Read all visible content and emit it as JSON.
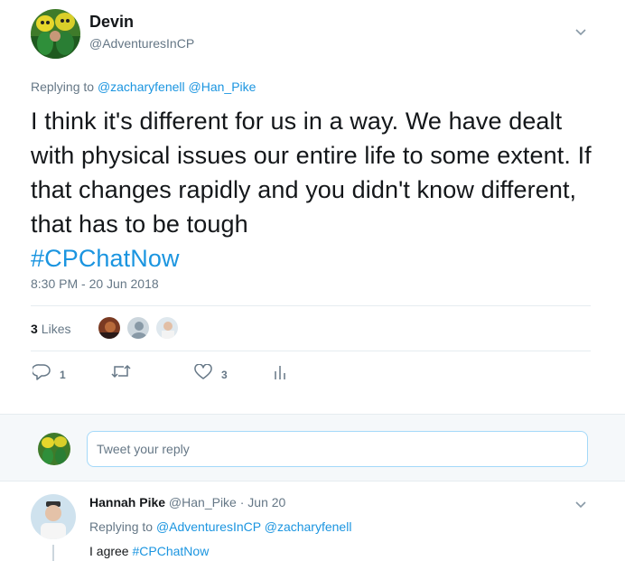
{
  "tweet": {
    "author_name": "Devin",
    "author_handle": "@AdventuresInCP",
    "replying_prefix": "Replying to",
    "replying_to": [
      "@zacharyfenell",
      "@Han_Pike"
    ],
    "text": "I think it's different for us in a way. We have dealt with physical issues our entire life to some extent. If that changes rapidly and you didn't know different, that has to be tough",
    "hashtag": "#CPChatNow",
    "timestamp": "8:30 PM - 20 Jun 2018",
    "likes_count": "3",
    "likes_label": "Likes",
    "actions": {
      "reply_count": "1",
      "retweet_count": "",
      "like_count": "3"
    }
  },
  "reply_box": {
    "placeholder": "Tweet your reply"
  },
  "reply_tweet": {
    "author_name": "Hannah Pike",
    "author_handle": "@Han_Pike",
    "separator": "·",
    "date": "Jun 20",
    "replying_prefix": "Replying to",
    "replying_to": [
      "@AdventuresInCP",
      "@zacharyfenell"
    ],
    "text": "I agree",
    "hashtag": "#CPChatNow"
  },
  "colors": {
    "link": "#1b95e0",
    "secondary_text": "#657786",
    "divider": "#e6ecf0",
    "reply_bg": "#f5f8fa"
  },
  "icons": {
    "more": "chevron-down-icon",
    "reply": "reply-icon",
    "retweet": "retweet-icon",
    "like": "heart-icon",
    "analytics": "analytics-icon"
  }
}
